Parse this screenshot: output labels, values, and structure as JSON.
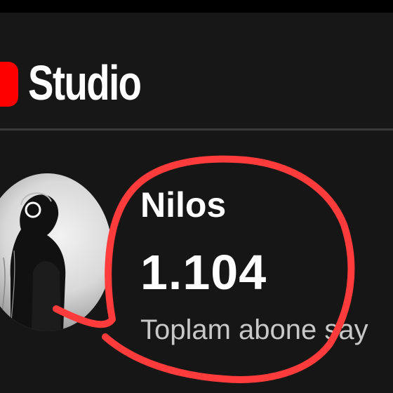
{
  "header": {
    "app_title": "Studio",
    "logo_icon": "youtube-logo-icon",
    "brand_color": "#ff0000"
  },
  "channel": {
    "name": "Nilos",
    "subscriber_count": "1.104",
    "subscriber_label": "Toplam abone say"
  },
  "annotation": {
    "color": "#ff3b3b"
  }
}
